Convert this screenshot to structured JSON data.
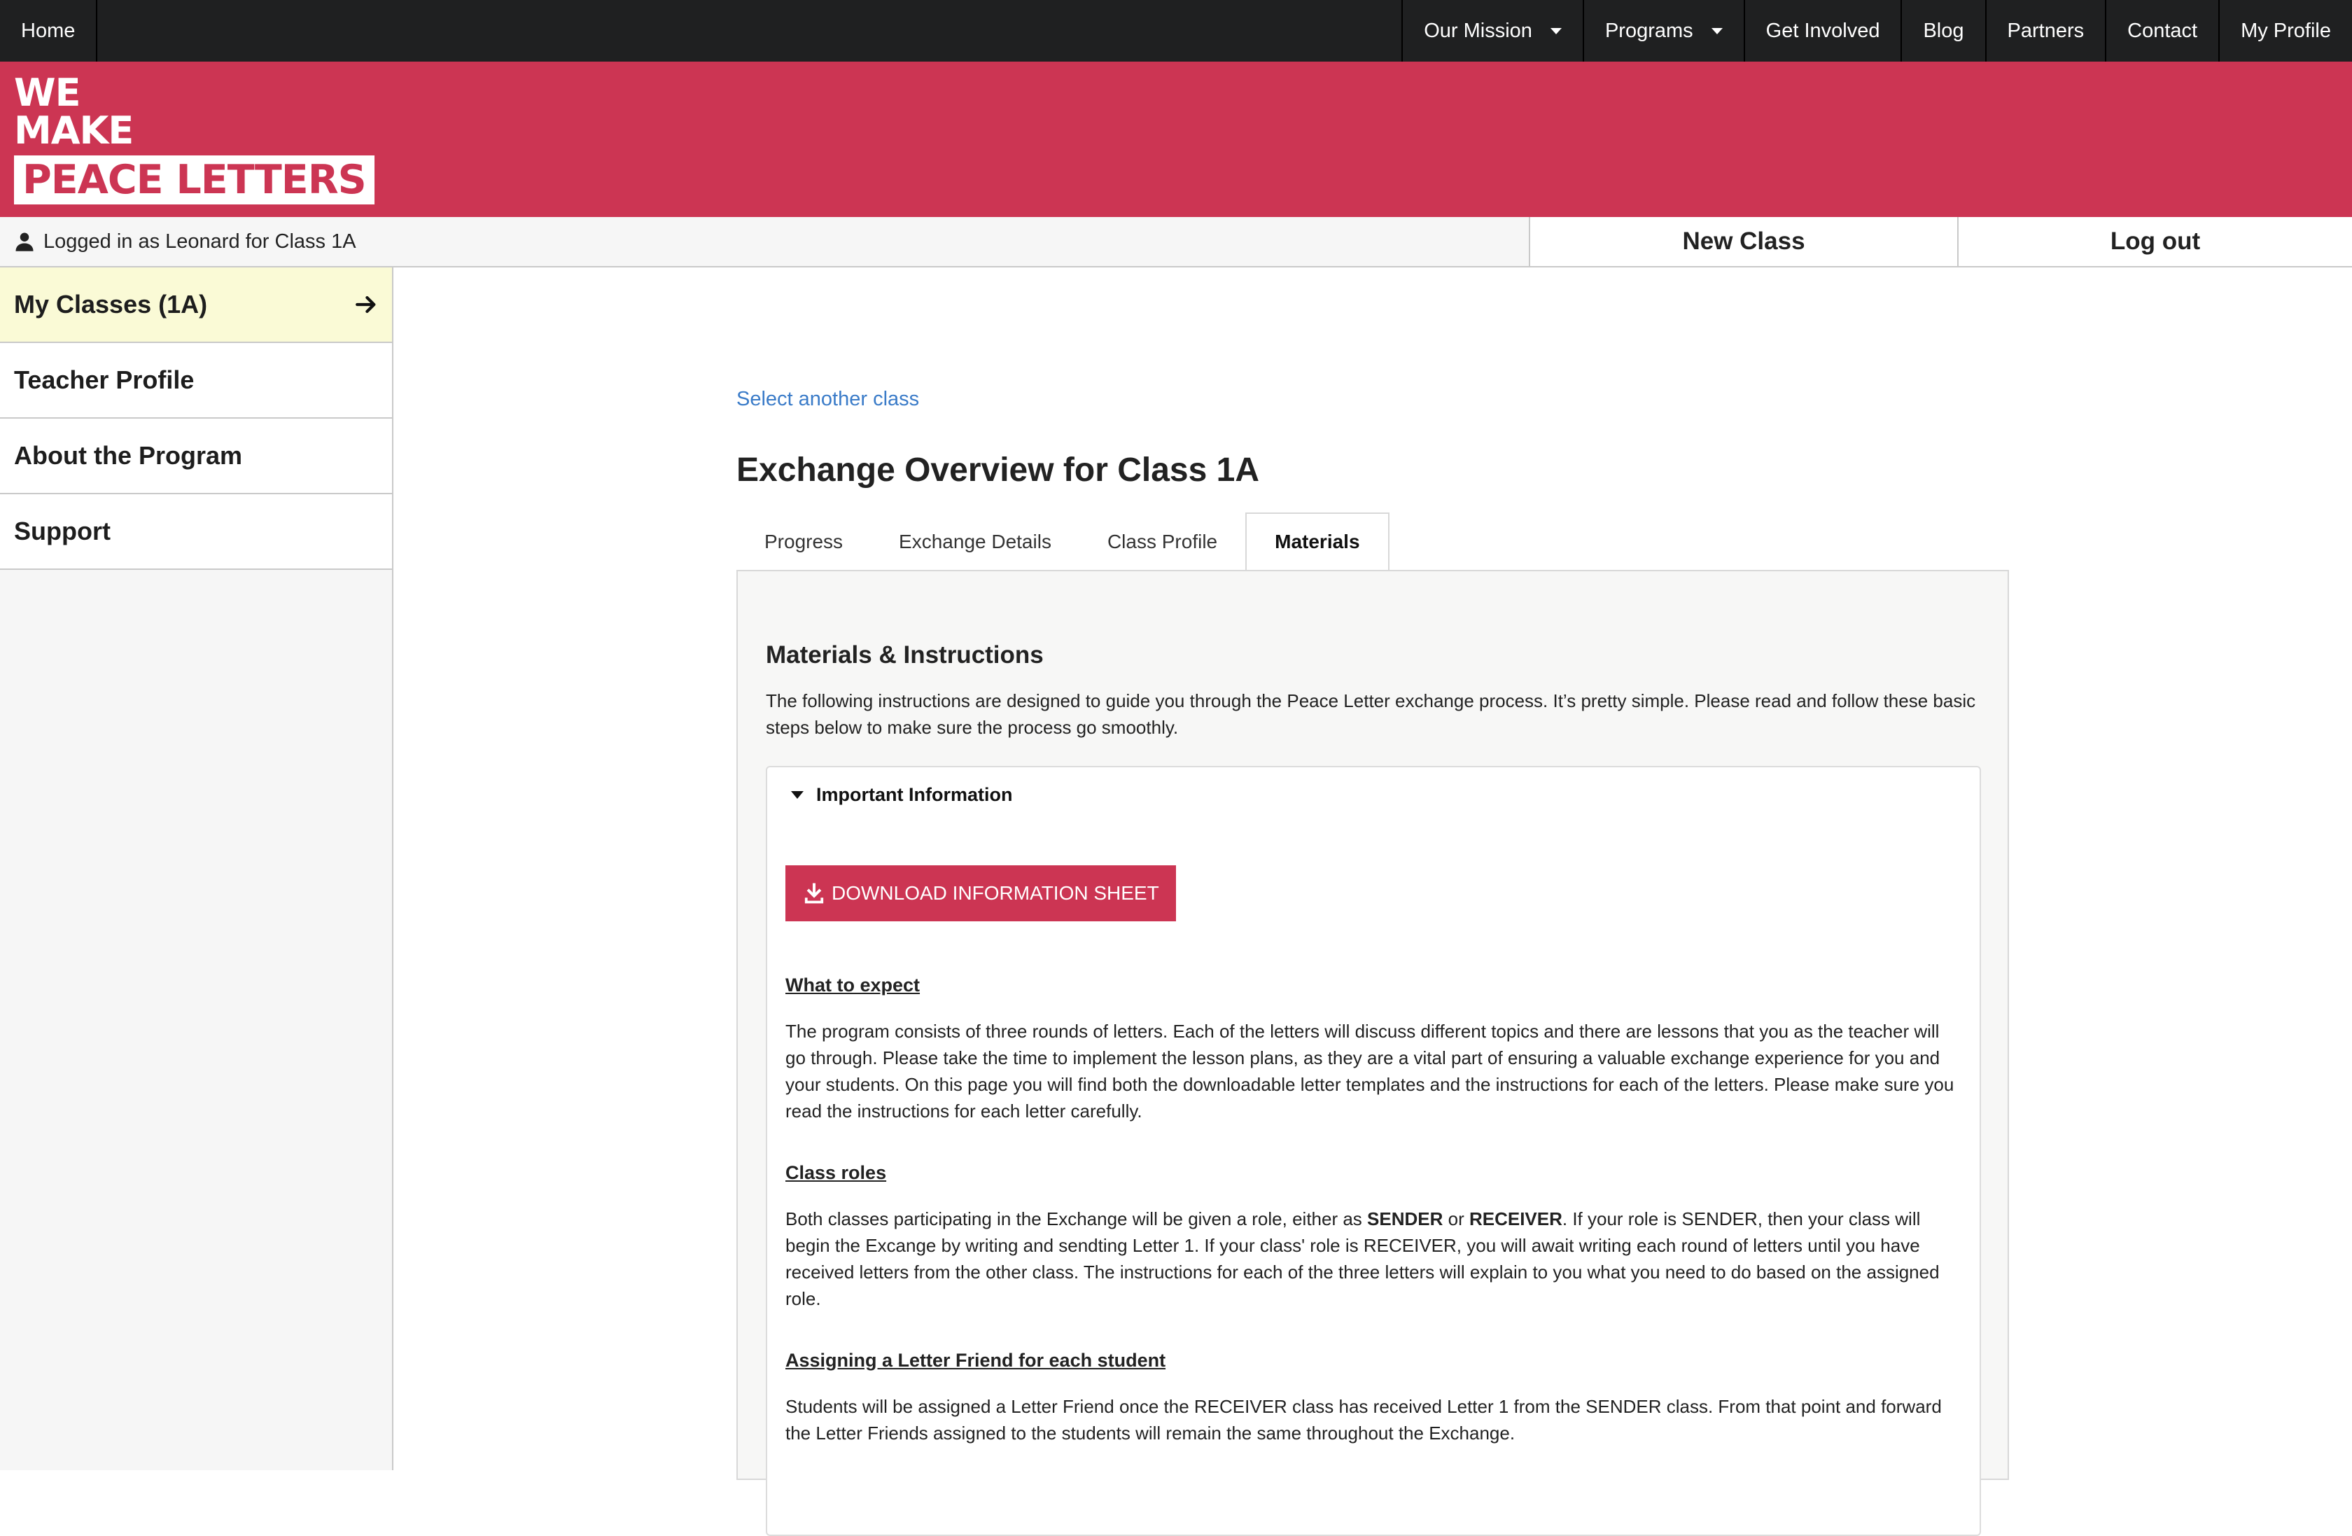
{
  "topnav": {
    "home": "Home",
    "items": [
      {
        "label": "Our Mission",
        "dropdown": true
      },
      {
        "label": "Programs",
        "dropdown": true
      },
      {
        "label": "Get Involved",
        "dropdown": false
      },
      {
        "label": "Blog",
        "dropdown": false
      },
      {
        "label": "Partners",
        "dropdown": false
      },
      {
        "label": "Contact",
        "dropdown": false
      },
      {
        "label": "My Profile",
        "dropdown": false
      }
    ]
  },
  "brand": {
    "line1": "WE",
    "line2": "MAKE",
    "line3": "PEACE LETTERS",
    "color": "#cc3553"
  },
  "loginbar": {
    "status": "Logged in as Leonard for Class 1A",
    "new_class": "New Class",
    "logout": "Log out"
  },
  "sidebar": {
    "items": [
      {
        "label": "My Classes (1A)",
        "active": true
      },
      {
        "label": "Teacher Profile"
      },
      {
        "label": "About the Program"
      },
      {
        "label": "Support"
      }
    ]
  },
  "main": {
    "select_link": "Select another class",
    "title": "Exchange Overview for Class 1A",
    "tabs": [
      {
        "label": "Progress"
      },
      {
        "label": "Exchange Details"
      },
      {
        "label": "Class Profile"
      },
      {
        "label": "Materials",
        "active": true
      }
    ],
    "panel": {
      "title": "Materials & Instructions",
      "intro": "The following instructions are designed to guide you through the Peace Letter exchange process. It’s pretty simple. Please read and follow these basic steps below to make sure the process go smoothly.",
      "details_summary": "Important Information",
      "download_button": "DOWNLOAD INFORMATION SHEET",
      "sections": [
        {
          "heading": "What to expect",
          "body": "The program consists of three rounds of letters. Each of the letters will discuss different topics and there are lessons that you as the teacher will go through. Please take the time to implement the lesson plans, as they are a vital part of ensuring a valuable exchange experience for you and your students. On this page you will find both the downloadable letter templates and the instructions for each of the letters. Please make sure you read the instructions for each letter carefully."
        },
        {
          "heading": "Class roles",
          "body_pre": "Both classes participating in the Exchange will be given a role, either as ",
          "role1": "SENDER",
          "body_mid": " or ",
          "role2": "RECEIVER",
          "body_post": ". If your role is SENDER, then your class will begin the Excange by writing and sendting Letter 1. If your class' role is RECEIVER, you will await writing each round of letters until you have received letters from the other class. The instructions for each of the three letters will explain to you what you need to do based on the assigned role."
        },
        {
          "heading": "Assigning a Letter Friend for each student",
          "body": "Students will be assigned a Letter Friend once the RECEIVER class has received Letter 1 from the SENDER class. From that point and forward the Letter Friends assigned to the students will remain the same throughout the Exchange."
        }
      ]
    }
  },
  "icons": {
    "user": "user-icon",
    "arrow": "arrow-right-icon",
    "download": "download-icon",
    "caret": "chevron-down-icon",
    "disclosure": "disclosure-triangle-icon"
  }
}
